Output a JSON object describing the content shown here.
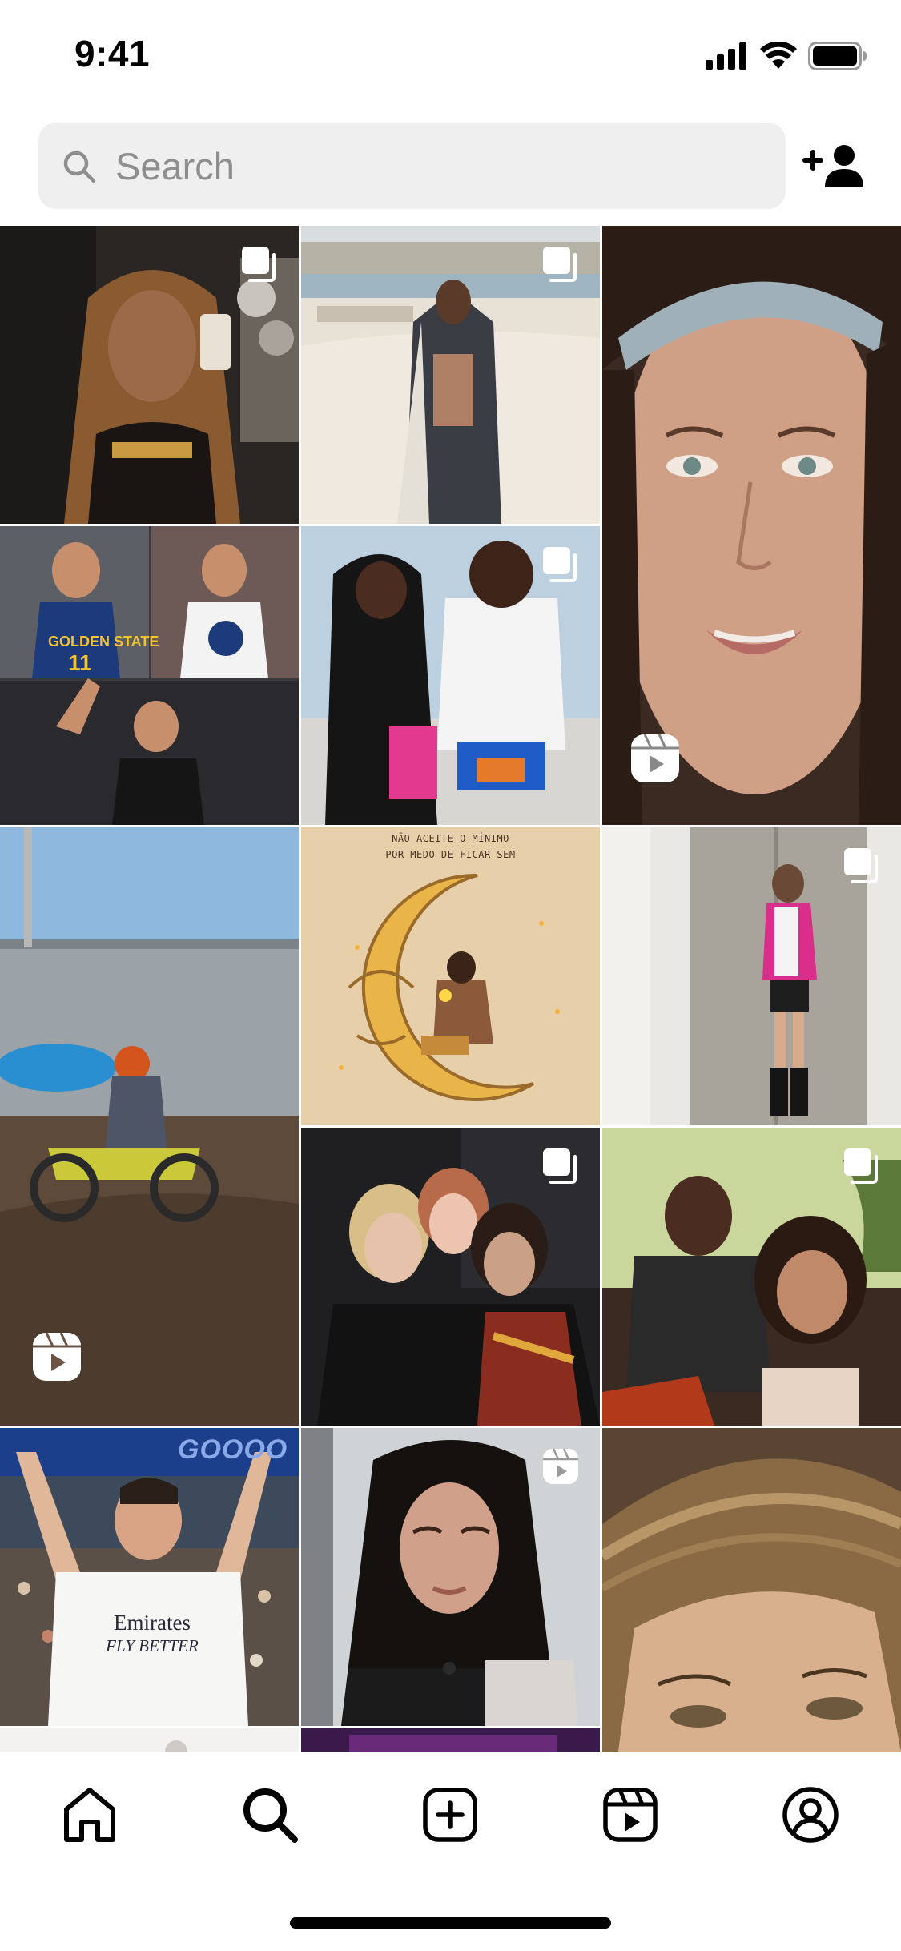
{
  "status_bar": {
    "time": "9:41",
    "icons": [
      "cellular-signal-icon",
      "wifi-icon",
      "battery-icon"
    ]
  },
  "search": {
    "placeholder": "Search",
    "value": "",
    "icon": "search-icon"
  },
  "header_action": {
    "icon": "add-person-icon"
  },
  "explore_grid": {
    "tiles": [
      {
        "name": "tile-1",
        "badge": "carousel"
      },
      {
        "name": "tile-2",
        "badge": "carousel"
      },
      {
        "name": "tile-3",
        "badge": "reel"
      },
      {
        "name": "tile-4",
        "badge": "none"
      },
      {
        "name": "tile-5",
        "badge": "carousel"
      },
      {
        "name": "tile-6",
        "badge": "reel"
      },
      {
        "name": "tile-7",
        "badge": "none",
        "caption": "NÃO ACEITE O MÍNIMO POR MEDO DE FICAR SEM"
      },
      {
        "name": "tile-8",
        "badge": "carousel"
      },
      {
        "name": "tile-9",
        "badge": "carousel"
      },
      {
        "name": "tile-10",
        "badge": "carousel"
      },
      {
        "name": "tile-11",
        "badge": "none",
        "jersey_text": [
          "Emirates",
          "FLY BETTER"
        ],
        "banner_text": "GOOOO"
      },
      {
        "name": "tile-12",
        "badge": "reel"
      },
      {
        "name": "tile-13",
        "badge": "none"
      }
    ]
  },
  "bottom_nav": {
    "items": [
      {
        "name": "home",
        "icon": "home-icon",
        "active": false
      },
      {
        "name": "search",
        "icon": "search-icon",
        "active": true
      },
      {
        "name": "create",
        "icon": "create-post-icon",
        "active": false
      },
      {
        "name": "reels",
        "icon": "reels-icon",
        "active": false
      },
      {
        "name": "profile",
        "icon": "profile-icon",
        "active": false
      }
    ]
  },
  "colors": {
    "search_background": "#efefef",
    "placeholder": "#8e8e8e",
    "icon": "#000000",
    "badge": "#ffffff"
  }
}
